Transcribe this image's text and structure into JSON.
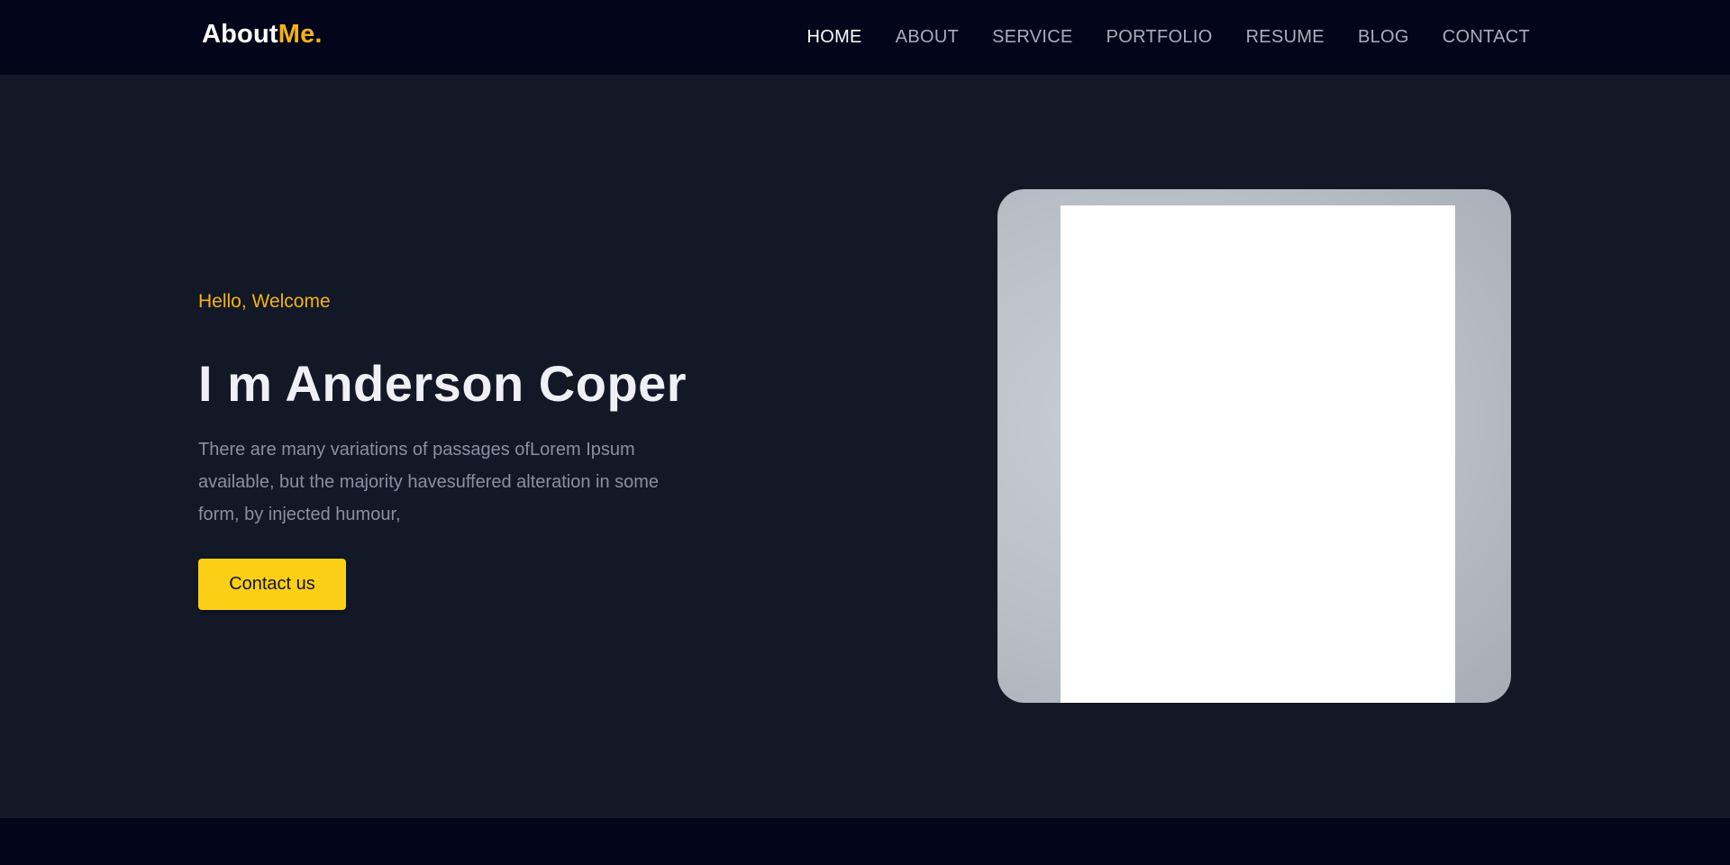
{
  "brand": {
    "name": "About",
    "accent": "Me."
  },
  "nav": {
    "items": [
      {
        "label": "HOME",
        "active": true
      },
      {
        "label": "ABOUT",
        "active": false
      },
      {
        "label": "SERVICE",
        "active": false
      },
      {
        "label": "PORTFOLIO",
        "active": false
      },
      {
        "label": "RESUME",
        "active": false
      },
      {
        "label": "BLOG",
        "active": false
      },
      {
        "label": "CONTACT",
        "active": false
      }
    ]
  },
  "hero": {
    "greeting": "Hello, Welcome",
    "title": "I m Anderson Coper",
    "description": "There are many variations of passages ofLorem Ipsum\n available, but the majority havesuffered alteration in some\nform, by injected humour,",
    "cta_label": "Contact us"
  },
  "colors": {
    "background": "#121826",
    "navbar": "#03061a",
    "accent": "#f5b316",
    "button": "#fccf16"
  }
}
